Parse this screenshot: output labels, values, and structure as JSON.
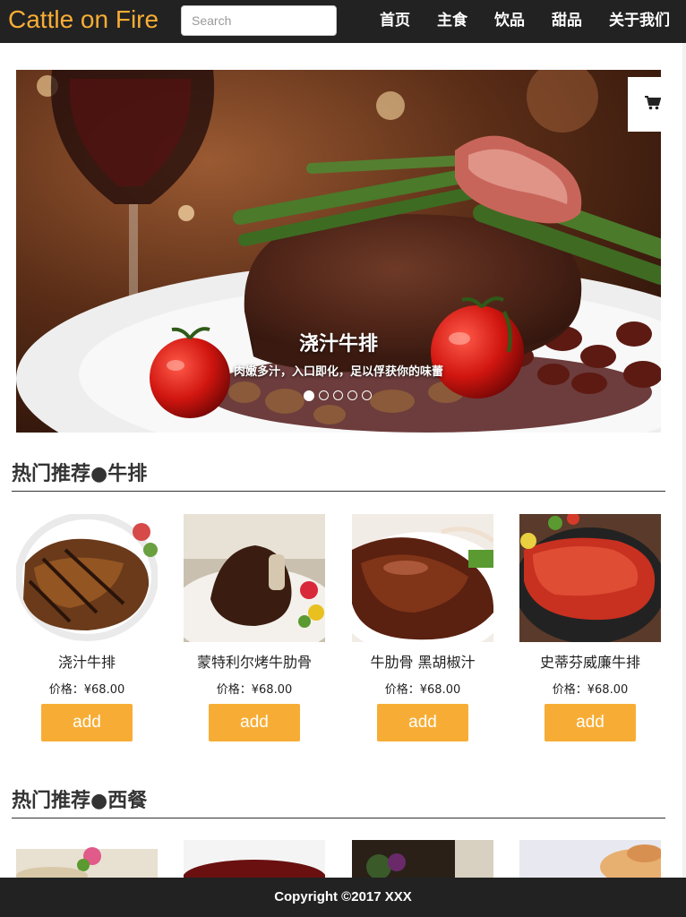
{
  "header": {
    "brand": "Cattle on Fire",
    "search_placeholder": "Search",
    "nav": [
      "首页",
      "主食",
      "饮品",
      "甜品",
      "关于我们"
    ]
  },
  "carousel": {
    "title": "浇汁牛排",
    "subtitle": "肉嫩多汁，入口即化，足以俘获你的味蕾",
    "slide_count": 5,
    "active_slide": 1,
    "cart_icon": "cart-icon"
  },
  "sections": [
    {
      "title": "热门推荐●牛排",
      "products": [
        {
          "name": "浇汁牛排",
          "price": "价格：¥68.00",
          "button": "add"
        },
        {
          "name": "蒙特利尔烤牛肋骨",
          "price": "价格：¥68.00",
          "button": "add"
        },
        {
          "name": "牛肋骨 黑胡椒汁",
          "price": "价格：¥68.00",
          "button": "add"
        },
        {
          "name": "史蒂芬威廉牛排",
          "price": "价格：¥68.00",
          "button": "add"
        }
      ]
    },
    {
      "title": "热门推荐●西餐"
    }
  ],
  "footer": {
    "copyright": "Copyright ©2017 XXX"
  },
  "colors": {
    "accent": "#f7ad35",
    "nav_bg": "#222222"
  }
}
